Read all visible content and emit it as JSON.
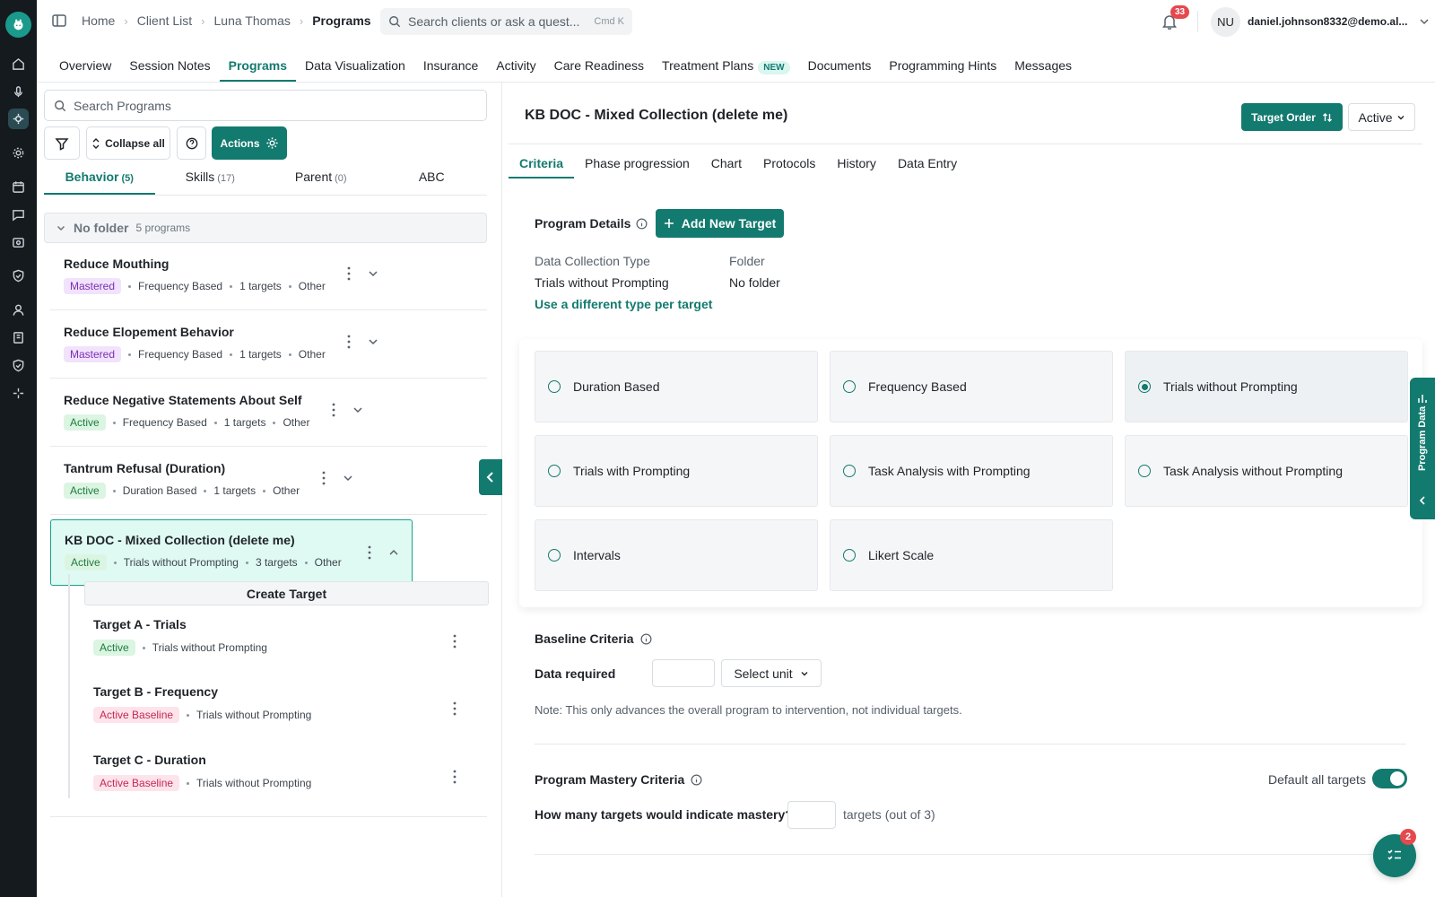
{
  "breadcrumb": [
    "Home",
    "Client List",
    "Luna Thomas",
    "Programs"
  ],
  "search": {
    "placeholder": "Search clients or ask a quest...",
    "shortcut": "Cmd K"
  },
  "notifications": {
    "count": "33"
  },
  "user": {
    "initials": "NU",
    "email": "daniel.johnson8332@demo.al..."
  },
  "nav_tabs": [
    {
      "label": "Overview"
    },
    {
      "label": "Session Notes"
    },
    {
      "label": "Programs"
    },
    {
      "label": "Data Visualization"
    },
    {
      "label": "Insurance"
    },
    {
      "label": "Activity"
    },
    {
      "label": "Care Readiness"
    },
    {
      "label": "Treatment Plans",
      "badge": "NEW"
    },
    {
      "label": "Documents"
    },
    {
      "label": "Programming Hints"
    },
    {
      "label": "Messages"
    }
  ],
  "left": {
    "search_placeholder": "Search Programs",
    "collapse_all": "Collapse all",
    "actions": "Actions",
    "tabs": [
      {
        "label": "Behavior",
        "count": "(5)"
      },
      {
        "label": "Skills",
        "count": "(17)"
      },
      {
        "label": "Parent",
        "count": "(0)"
      },
      {
        "label": "ABC",
        "count": ""
      }
    ],
    "folder": {
      "name": "No folder",
      "count": "5 programs"
    },
    "programs": [
      {
        "title": "Reduce Mouthing",
        "status": "Mastered",
        "type": "Frequency Based",
        "targets": "1 targets",
        "category": "Other"
      },
      {
        "title": "Reduce Elopement Behavior",
        "status": "Mastered",
        "type": "Frequency Based",
        "targets": "1 targets",
        "category": "Other"
      },
      {
        "title": "Reduce Negative Statements About Self",
        "status": "Active",
        "type": "Frequency Based",
        "targets": "1 targets",
        "category": "Other"
      },
      {
        "title": "Tantrum Refusal (Duration)",
        "status": "Active",
        "type": "Duration Based",
        "targets": "1 targets",
        "category": "Other"
      },
      {
        "title": "KB DOC - Mixed Collection (delete me)",
        "status": "Active",
        "type": "Trials without Prompting",
        "targets": "3 targets",
        "category": "Other"
      }
    ],
    "create_target": "Create Target",
    "targets": [
      {
        "title": "Target A - Trials",
        "status": "Active",
        "type": "Trials without Prompting"
      },
      {
        "title": "Target B - Frequency",
        "status": "Active Baseline",
        "type": "Trials without Prompting"
      },
      {
        "title": "Target C - Duration",
        "status": "Active Baseline",
        "type": "Trials without Prompting"
      }
    ]
  },
  "right": {
    "title": "KB DOC - Mixed Collection (delete me)",
    "target_order": "Target Order",
    "status_select": "Active",
    "tabs": [
      "Criteria",
      "Phase progression",
      "Chart",
      "Protocols",
      "History",
      "Data Entry"
    ],
    "program_details": "Program Details",
    "add_new_target": "Add New Target",
    "dct_label": "Data Collection Type",
    "dct_value": "Trials without Prompting",
    "folder_label": "Folder",
    "folder_value": "No folder",
    "different_type": "Use a different type per target",
    "options": [
      {
        "label": "Duration Based",
        "selected": false
      },
      {
        "label": "Frequency Based",
        "selected": false
      },
      {
        "label": "Trials without Prompting",
        "selected": true
      },
      {
        "label": "Trials with Prompting",
        "selected": false
      },
      {
        "label": "Task Analysis with Prompting",
        "selected": false
      },
      {
        "label": "Task Analysis without Prompting",
        "selected": false
      },
      {
        "label": "Intervals",
        "selected": false
      },
      {
        "label": "Likert Scale",
        "selected": false
      }
    ],
    "program_data_tab": "Program Data",
    "baseline_title": "Baseline Criteria",
    "data_required": "Data required",
    "select_unit": "Select unit",
    "note": "Note: This only advances the overall program to intervention, not individual targets.",
    "mastery_title": "Program Mastery Criteria",
    "default_all": "Default all targets",
    "mastery_question": "How many targets would indicate mastery?",
    "mastery_suffix": "targets (out of 3)"
  },
  "fab": {
    "badge": "2"
  },
  "colors": {
    "accent": "#137a6f",
    "rail": "#151a1f",
    "selected_bg": "#dffaf3"
  }
}
